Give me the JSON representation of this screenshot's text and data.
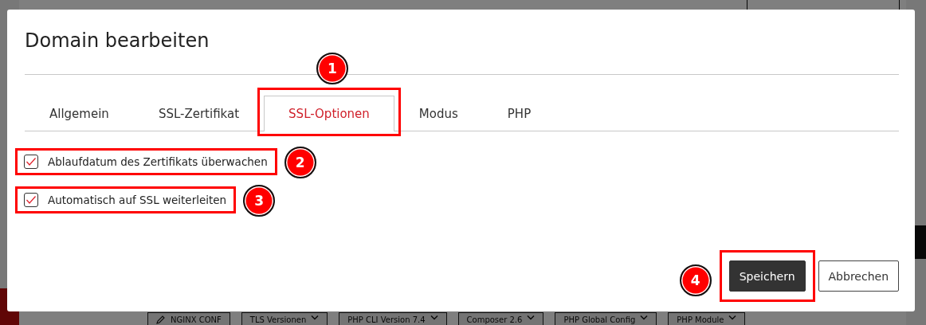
{
  "background": {
    "toolbar": [
      {
        "label": "NGINX CONF",
        "kind": "edit"
      },
      {
        "label": "TLS Versionen",
        "kind": "dropdown"
      },
      {
        "label": "PHP CLI Version 7.4",
        "kind": "dropdown"
      },
      {
        "label": "Composer 2.6",
        "kind": "dropdown"
      },
      {
        "label": "PHP Global Config",
        "kind": "dropdown"
      },
      {
        "label": "PHP Module",
        "kind": "dropdown"
      }
    ]
  },
  "dialog": {
    "title": "Domain bearbeiten",
    "tabs": [
      {
        "label": "Allgemein",
        "selected": false
      },
      {
        "label": "SSL-Zertifikat",
        "selected": false
      },
      {
        "label": "SSL-Optionen",
        "selected": true,
        "annotation": "1"
      },
      {
        "label": "Modus",
        "selected": false
      },
      {
        "label": "PHP",
        "selected": false
      }
    ],
    "options": [
      {
        "label": "Ablaufdatum des Zertifikats überwachen",
        "checked": true,
        "annotation": "2"
      },
      {
        "label": "Automatisch auf SSL weiterleiten",
        "checked": true,
        "annotation": "3"
      }
    ],
    "buttons": [
      {
        "label": "Speichern",
        "kind": "primary",
        "annotation": "4"
      },
      {
        "label": "Abbrechen",
        "kind": "secondary"
      }
    ]
  }
}
